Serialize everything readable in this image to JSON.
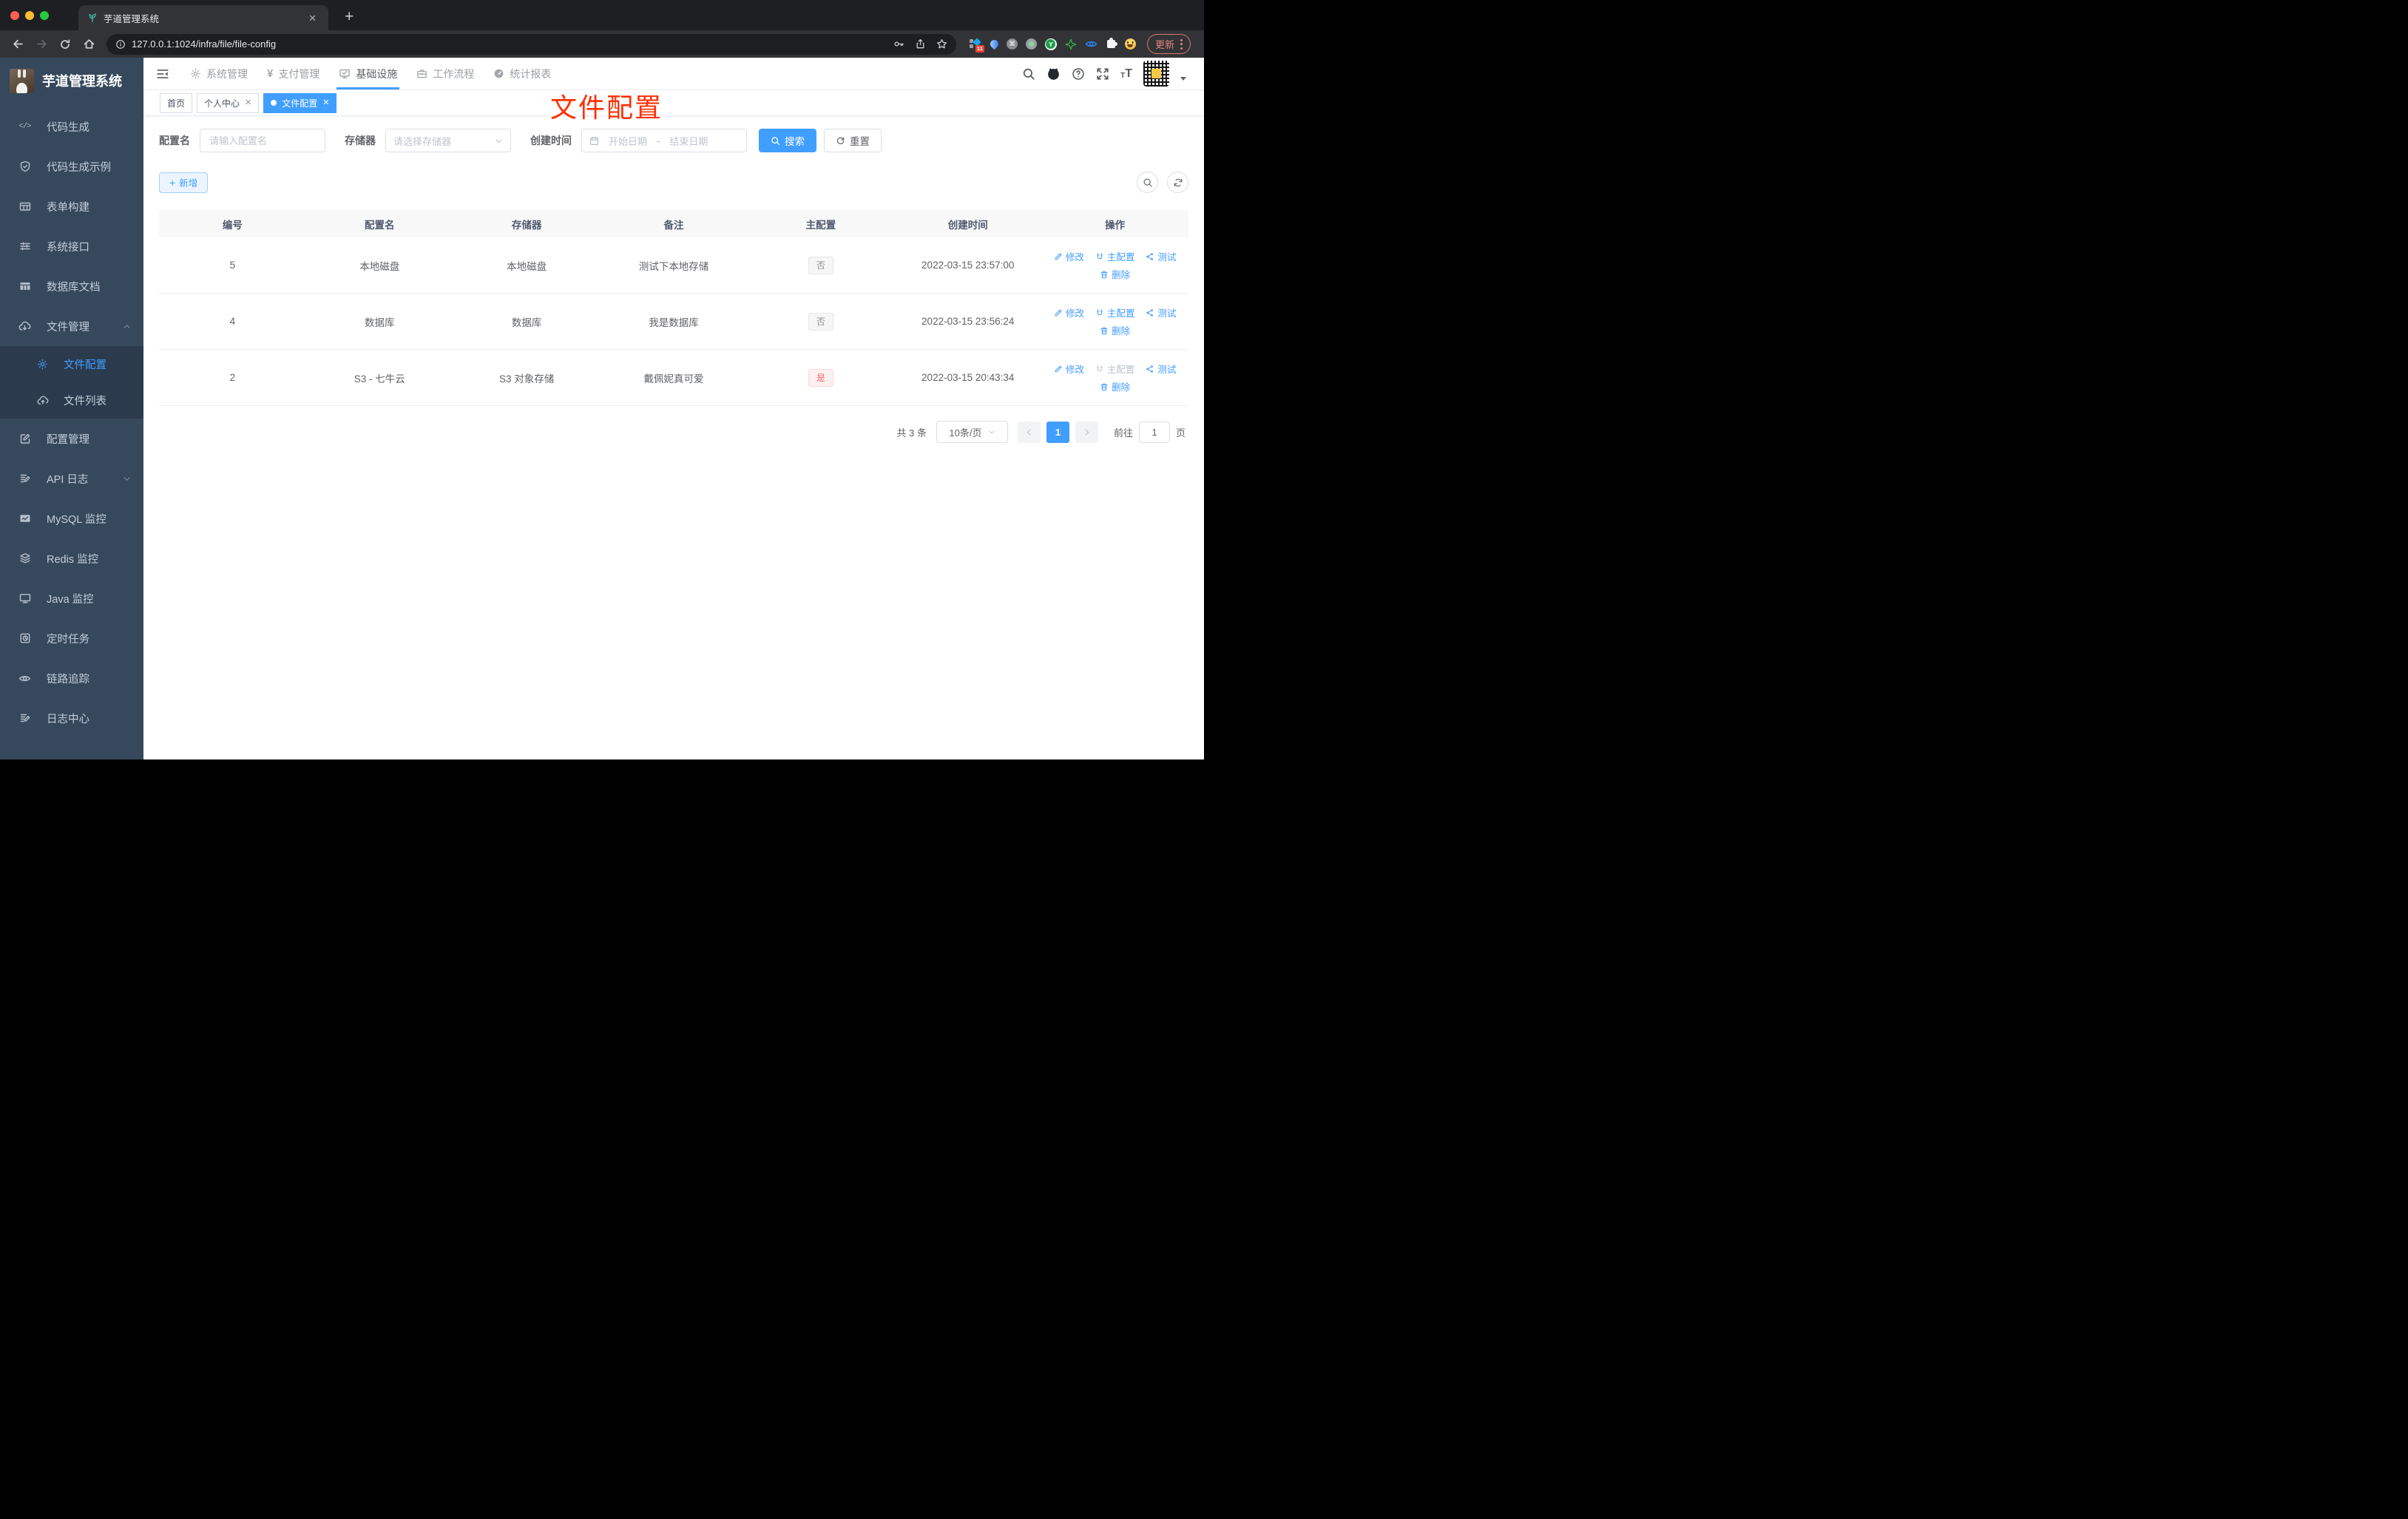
{
  "browser": {
    "tab_title": "芋道管理系统",
    "url": "127.0.0.1:1024/infra/file/file-config",
    "update_label": "更新",
    "extension_badge": "11"
  },
  "sidebar": {
    "title": "芋道管理系统",
    "items": [
      {
        "label": "代码生成"
      },
      {
        "label": "代码生成示例"
      },
      {
        "label": "表单构建"
      },
      {
        "label": "系统接口"
      },
      {
        "label": "数据库文档"
      },
      {
        "label": "文件管理",
        "children": [
          {
            "label": "文件配置"
          },
          {
            "label": "文件列表"
          }
        ]
      },
      {
        "label": "配置管理"
      },
      {
        "label": "API 日志"
      },
      {
        "label": "MySQL 监控"
      },
      {
        "label": "Redis 监控"
      },
      {
        "label": "Java 监控"
      },
      {
        "label": "定时任务"
      },
      {
        "label": "链路追踪"
      },
      {
        "label": "日志中心"
      }
    ]
  },
  "navbar": {
    "menus": [
      {
        "label": "系统管理"
      },
      {
        "label": "支付管理"
      },
      {
        "label": "基础设施"
      },
      {
        "label": "工作流程"
      },
      {
        "label": "统计报表"
      }
    ]
  },
  "tags": [
    {
      "label": "首页"
    },
    {
      "label": "个人中心"
    },
    {
      "label": "文件配置"
    }
  ],
  "annotation": {
    "text": "文件配置",
    "color": "#ff2e00"
  },
  "filters": {
    "config_name_label": "配置名",
    "config_name_placeholder": "请输入配置名",
    "storage_label": "存储器",
    "storage_placeholder": "请选择存储器",
    "create_time_label": "创建时间",
    "date_start_placeholder": "开始日期",
    "date_separator": "-",
    "date_end_placeholder": "结束日期",
    "search_label": "搜索",
    "reset_label": "重置"
  },
  "toolbar": {
    "add_label": "新增"
  },
  "table": {
    "columns": [
      "编号",
      "配置名",
      "存储器",
      "备注",
      "主配置",
      "创建时间",
      "操作"
    ],
    "actions": {
      "edit": "修改",
      "master": "主配置",
      "test": "测试",
      "delete": "删除"
    },
    "rows": [
      {
        "id": "5",
        "name": "本地磁盘",
        "storage": "本地磁盘",
        "remark": "测试下本地存储",
        "master": "否",
        "master_type": "info",
        "created": "2022-03-15 23:57:00"
      },
      {
        "id": "4",
        "name": "数据库",
        "storage": "数据库",
        "remark": "我是数据库",
        "master": "否",
        "master_type": "info",
        "created": "2022-03-15 23:56:24"
      },
      {
        "id": "2",
        "name": "S3 - 七牛云",
        "storage": "S3 对象存储",
        "remark": "戴佩妮真可爱",
        "master": "是",
        "master_type": "danger",
        "created": "2022-03-15 20:43:34"
      }
    ]
  },
  "pagination": {
    "total_text": "共 3 条",
    "page_size": "10条/页",
    "current_page": "1",
    "goto_label": "前往",
    "goto_value": "1",
    "page_label": "页"
  },
  "colors": {
    "accent": "#409eff",
    "danger": "#f56c6c",
    "sidebar": "#36485c"
  }
}
